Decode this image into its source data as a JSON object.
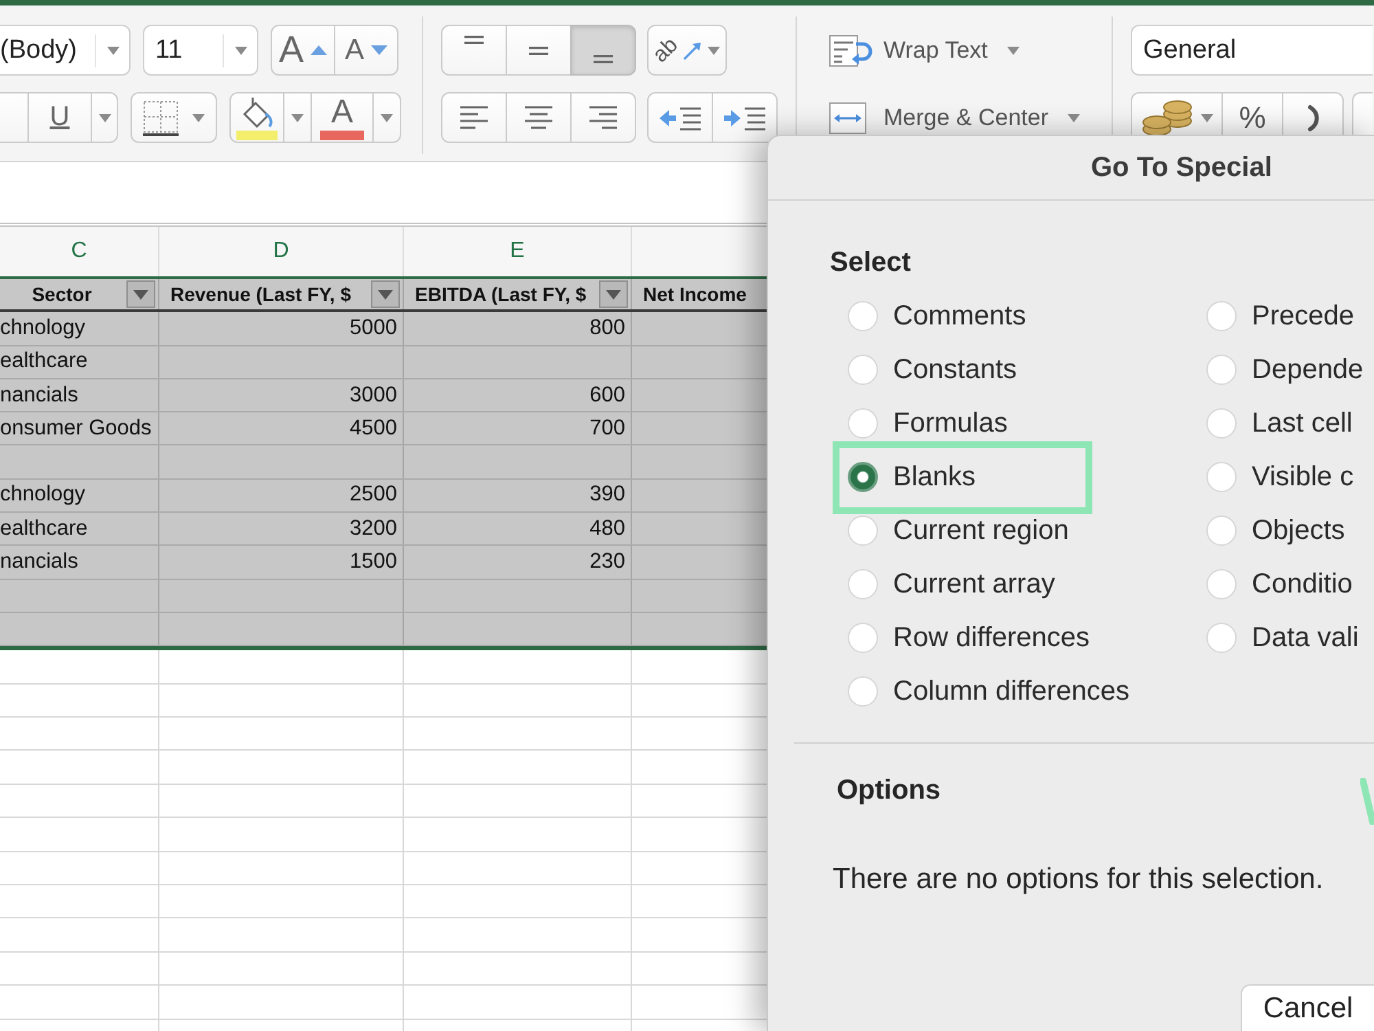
{
  "ribbon": {
    "font_name": {
      "value": "(Body)"
    },
    "font_size": {
      "value": "11"
    },
    "font_size_buttons": [
      {
        "kind": "grow",
        "label": "A"
      },
      {
        "kind": "shrink",
        "label": "A"
      }
    ],
    "underline_button": {
      "label": "U"
    },
    "font_color_button": {
      "label": "A"
    },
    "vertical_align": [
      {
        "kind": "top",
        "selected": false
      },
      {
        "kind": "middle",
        "selected": false
      },
      {
        "kind": "bottom",
        "selected": true
      }
    ],
    "orientation_button": {
      "label": "ab"
    },
    "horizontal_align": [
      {
        "kind": "left",
        "selected": false
      },
      {
        "kind": "center",
        "selected": false
      },
      {
        "kind": "right",
        "selected": false
      }
    ],
    "wrap_text": {
      "label": "Wrap Text"
    },
    "merge_center": {
      "label": "Merge & Center"
    },
    "number_format": {
      "value": "General"
    },
    "percent_button": {
      "label": "%"
    }
  },
  "sheet": {
    "column_headers": [
      "C",
      "D",
      "E"
    ],
    "table": {
      "selected": true,
      "columns": [
        {
          "label": "Sector",
          "filter_button": true
        },
        {
          "label": "Revenue (Last FY, $",
          "filter_button": true
        },
        {
          "label": "EBITDA (Last FY, $",
          "filter_button": true
        },
        {
          "label": "Net Income",
          "filter_button": false
        }
      ],
      "rows": [
        {
          "sector": "chnology",
          "revenue": "5000",
          "ebitda": "800"
        },
        {
          "sector": "ealthcare"
        },
        {
          "sector": "nancials",
          "revenue": "3000",
          "ebitda": "600"
        },
        {
          "sector": "onsumer Goods",
          "revenue": "4500",
          "ebitda": "700"
        },
        {},
        {
          "sector": "chnology",
          "revenue": "2500",
          "ebitda": "390"
        },
        {
          "sector": "ealthcare",
          "revenue": "3200",
          "ebitda": "480"
        },
        {
          "sector": "nancials",
          "revenue": "1500",
          "ebitda": "230"
        },
        {},
        {}
      ]
    }
  },
  "dialog": {
    "title": "Go To Special",
    "select_heading": "Select",
    "select_options": [
      {
        "label": "Comments",
        "selected": false,
        "highlighted": false
      },
      {
        "label": "Constants",
        "selected": false,
        "highlighted": false
      },
      {
        "label": "Formulas",
        "selected": false,
        "highlighted": false
      },
      {
        "label": "Blanks",
        "selected": true,
        "highlighted": true
      },
      {
        "label": "Current region",
        "selected": false,
        "highlighted": false
      },
      {
        "label": "Current array",
        "selected": false,
        "highlighted": false
      },
      {
        "label": "Row differences",
        "selected": false,
        "highlighted": false
      },
      {
        "label": "Column differences",
        "selected": false,
        "highlighted": false
      },
      {
        "label": "Precede",
        "selected": false,
        "highlighted": false
      },
      {
        "label": "Depende",
        "selected": false,
        "highlighted": false
      },
      {
        "label": "Last cell",
        "selected": false,
        "highlighted": false
      },
      {
        "label": "Visible c",
        "selected": false,
        "highlighted": false
      },
      {
        "label": "Objects",
        "selected": false,
        "highlighted": false
      },
      {
        "label": "Conditio",
        "selected": false,
        "highlighted": false
      },
      {
        "label": "Data vali",
        "selected": false,
        "highlighted": false
      }
    ],
    "options_heading": "Options",
    "options_message": "There are no options for this selection.",
    "buttons": [
      {
        "label": "Cancel"
      }
    ]
  }
}
